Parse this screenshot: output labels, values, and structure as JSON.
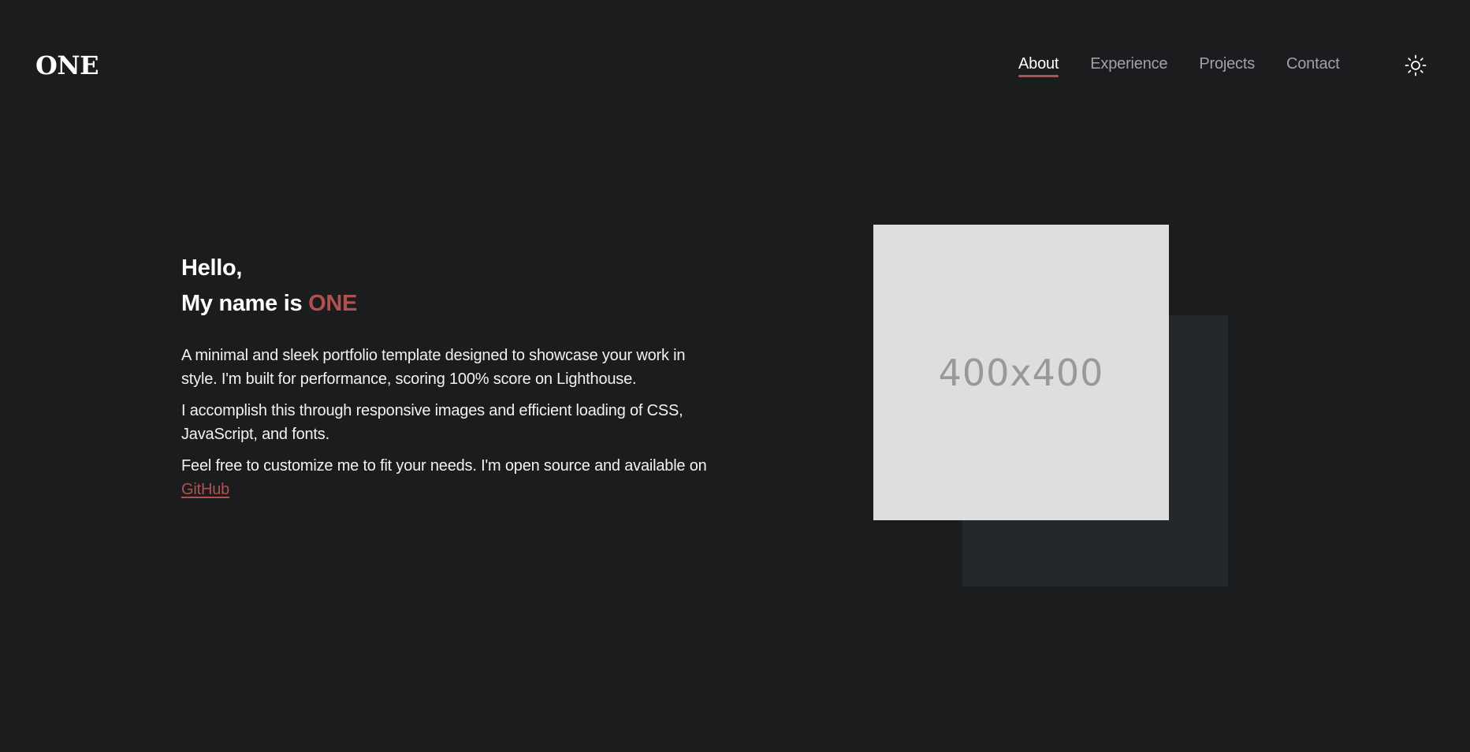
{
  "brand": {
    "logo": "ONE"
  },
  "nav": {
    "items": [
      {
        "label": "About",
        "active": true
      },
      {
        "label": "Experience",
        "active": false
      },
      {
        "label": "Projects",
        "active": false
      },
      {
        "label": "Contact",
        "active": false
      }
    ],
    "theme_toggle_icon": "sun-icon"
  },
  "hero": {
    "greeting_line1": "Hello,",
    "greeting_line2_prefix": "My name is ",
    "greeting_name": "ONE",
    "paragraph1": "A minimal and sleek portfolio template designed to showcase your work in style. I'm built for performance, scoring 100% score on Lighthouse.",
    "paragraph2": "I accomplish this through responsive images and efficient loading of CSS, JavaScript, and fonts.",
    "paragraph3_prefix": "Feel free to customize me to fit your needs. I'm open source and available on ",
    "github_link": "GitHub"
  },
  "image": {
    "placeholder_text": "400x400"
  },
  "colors": {
    "background": "#1b1c1e",
    "accent": "#b05150",
    "nav_inactive": "#a0a2a6",
    "placeholder_bg": "#dedede",
    "placeholder_shadow": "#25282a"
  }
}
